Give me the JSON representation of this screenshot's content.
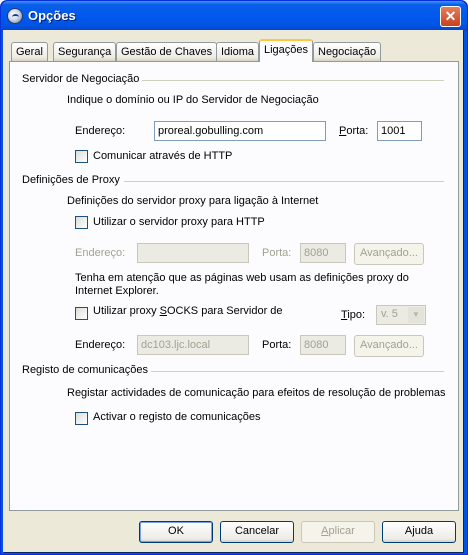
{
  "window": {
    "title": "Opções"
  },
  "tabs": [
    "Geral",
    "Segurança",
    "Gestão de Chaves",
    "Idioma",
    "Ligações",
    "Negociação"
  ],
  "server": {
    "section_title": "Servidor de Negociação",
    "description": "Indique o domínio ou IP do Servidor de Negociação",
    "address_label": "Endereço:",
    "address_value": "proreal.gobulling.com",
    "port_label": "Porta:",
    "port_value": "1001",
    "http_label": "Comunicar através de HTTP"
  },
  "proxy": {
    "section_title": "Definições de Proxy",
    "description": "Definições do servidor proxy para ligação à Internet",
    "http_proxy_label": "Utilizar o servidor proxy para HTTP",
    "address_label": "Endereço:",
    "address_value": "",
    "port_label": "Porta:",
    "port_value": "8080",
    "advanced_label": "Avançado...",
    "note": "Tenha em atenção que as páginas web usam as definições proxy do",
    "note2": "Internet Explorer.",
    "socks_label": "Utilizar proxy SOCKS para Servidor de",
    "type_label": "Tipo:",
    "type_value": "v. 5",
    "socks_address_label": "Endereço:",
    "socks_address_value": "dc103.ljc.local",
    "socks_port_label": "Porta:",
    "socks_port_value": "8080",
    "socks_advanced_label": "Avançado..."
  },
  "log": {
    "section_title": "Registo de comunicações",
    "description": "Registar actividades de  comunicação para efeitos de resolução de problemas",
    "enable_label": "Activar o registo de comunicações"
  },
  "buttons": {
    "ok": "OK",
    "cancel": "Cancelar",
    "apply": "Aplicar",
    "help": "Ajuda"
  }
}
